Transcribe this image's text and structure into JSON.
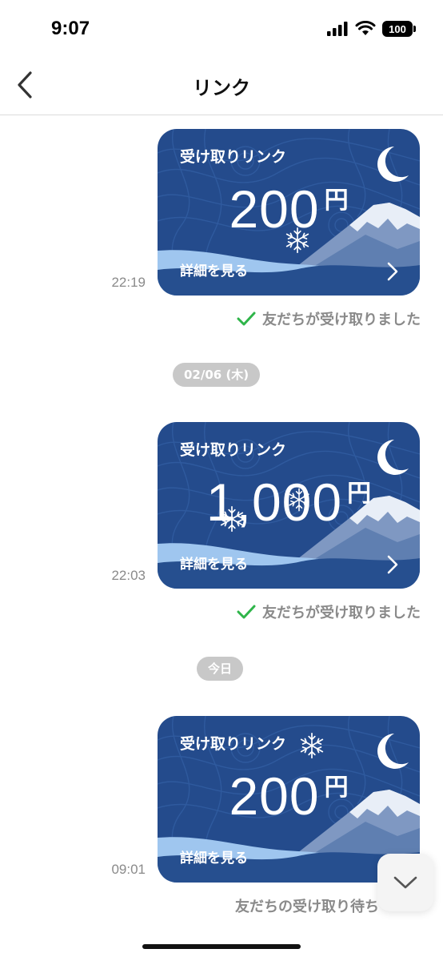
{
  "status_bar": {
    "time": "9:07",
    "battery": "100",
    "icons": [
      "signal-icon",
      "wifi-icon",
      "battery-icon"
    ]
  },
  "nav": {
    "title": "リンク",
    "back_icon": "chevron-left-icon"
  },
  "messages": [
    {
      "card_title": "受け取りリンク",
      "amount": "200",
      "currency": "円",
      "detail": "詳細を見る",
      "time": "22:19",
      "status": "友だちが受け取りました",
      "status_icon": "check-icon"
    },
    {
      "card_title": "受け取りリンク",
      "amount": "1,000",
      "currency": "円",
      "detail": "詳細を見る",
      "time": "22:03",
      "status": "友だちが受け取りました",
      "status_icon": "check-icon"
    },
    {
      "card_title": "受け取りリンク",
      "amount": "200",
      "currency": "円",
      "detail": "詳細を見る",
      "time": "09:01",
      "status": "友だちの受け取り待ち"
    }
  ],
  "date_separators": [
    "02/06 (木)",
    "今日"
  ],
  "colors": {
    "card_blue": "#244b8c",
    "check_green": "#2fb54a",
    "pill_gray": "#c8c8c8"
  }
}
